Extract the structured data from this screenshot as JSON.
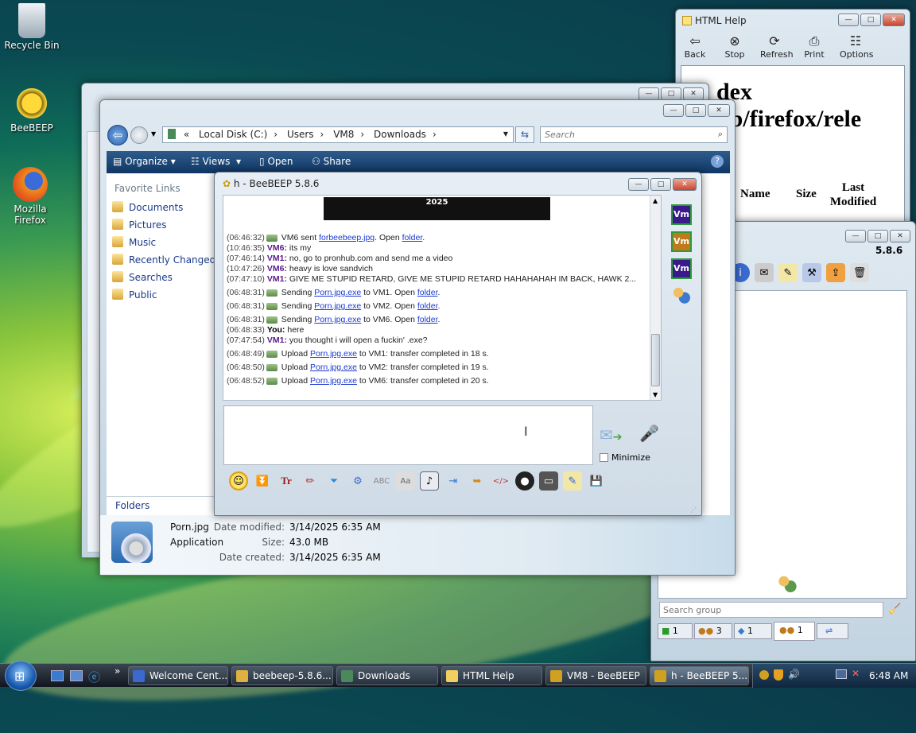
{
  "desktop": {
    "icons": [
      {
        "label": "Recycle Bin",
        "icon": "recycle-bin-icon"
      },
      {
        "label": "BeeBEEP",
        "icon": "bee-icon"
      },
      {
        "label": "Mozilla Firefox",
        "icon": "firefox-icon"
      }
    ]
  },
  "htmlhelp": {
    "title": "HTML Help",
    "buttons": [
      "Back",
      "Stop",
      "Refresh",
      "Print",
      "Options"
    ],
    "heading1": "dex",
    "heading2": "ub/firefox/rele",
    "col_name": "Name",
    "col_size": "Size",
    "col_last": "Last Modified"
  },
  "explorer": {
    "breadcrumb": [
      "Local Disk (C:)",
      "Users",
      "VM8",
      "Downloads"
    ],
    "search_placeholder": "Search",
    "toolbar": [
      "Organize",
      "Views",
      "Open",
      "Share"
    ],
    "favorite_header": "Favorite Links",
    "links": [
      "Documents",
      "Pictures",
      "Music",
      "Recently Changed",
      "Searches",
      "Public"
    ],
    "folders": "Folders",
    "file": {
      "name": "Porn.jpg",
      "type": "Application",
      "modified_label": "Date modified:",
      "modified": "3/14/2025 6:35 AM",
      "size_label": "Size:",
      "size": "43.0 MB",
      "created_label": "Date created:",
      "created": "3/14/2025 6:35 AM"
    }
  },
  "beebeep": {
    "title": "h - BeeBEEP 5.8.6",
    "banner": "2025",
    "messages": [
      {
        "ts": "(06:46:32)",
        "pre": " VM6 sent ",
        "link": "forbeebeep.jpg",
        "post": ". Open ",
        "link2": "folder",
        "end": ".",
        "sys": true
      },
      {
        "ts": "(10:46:35)",
        "nick": "VM6:",
        "text": " its my"
      },
      {
        "ts": "(07:46:14)",
        "nick": "VM1:",
        "text": " no, go to pronhub.com and send me a video"
      },
      {
        "ts": "(10:47:26)",
        "nick": "VM6:",
        "text": " heavy is love sandvich"
      },
      {
        "ts": "(07:47:10)",
        "nick": "VM1:",
        "text": " GIVE ME STUPID RETARD, GIVE ME STUPID RETARD HAHAHAHAH IM BACK, HAWK 2..."
      },
      {
        "ts": "(06:48:31)",
        "pre": " Sending ",
        "link": "Porn.jpg.exe",
        "post": " to VM1. Open ",
        "link2": "folder",
        "end": ".",
        "sys": true
      },
      {
        "ts": "(06:48:31)",
        "pre": " Sending ",
        "link": "Porn.jpg.exe",
        "post": " to VM2. Open ",
        "link2": "folder",
        "end": ".",
        "sys": true
      },
      {
        "ts": "(06:48:31)",
        "pre": " Sending ",
        "link": "Porn.jpg.exe",
        "post": " to VM6. Open ",
        "link2": "folder",
        "end": ".",
        "sys": true
      },
      {
        "ts": "(06:48:33)",
        "nick": "You:",
        "text": " here",
        "you": true
      },
      {
        "ts": "(07:47:54)",
        "nick": "VM1:",
        "text": " you thought i will open a fuckin' .exe?"
      },
      {
        "ts": "(06:48:49)",
        "pre": " Upload ",
        "link": "Porn.jpg.exe",
        "post": " to VM1: transfer completed in 18 s.",
        "sys": true
      },
      {
        "ts": "(06:48:50)",
        "pre": " Upload ",
        "link": "Porn.jpg.exe",
        "post": " to VM2: transfer completed in 19 s.",
        "sys": true
      },
      {
        "ts": "(06:48:52)",
        "pre": " Upload ",
        "link": "Porn.jpg.exe",
        "post": " to VM6: transfer completed in 20 s.",
        "sys": true
      }
    ],
    "minimize_label": "Minimize",
    "vm_labels": [
      "Vm",
      "Vm",
      "Vm"
    ]
  },
  "beebeep2": {
    "version": "5.8.6",
    "search_placeholder": "Search group",
    "tabs": [
      "1",
      "3",
      "1",
      "1"
    ]
  },
  "taskbar": {
    "items": [
      "Welcome Cent...",
      "beebeep-5.8.6...",
      "Downloads",
      "HTML Help",
      "VM8 - BeeBEEP",
      "h - BeeBEEP 5...."
    ],
    "clock": "6:48 AM"
  }
}
